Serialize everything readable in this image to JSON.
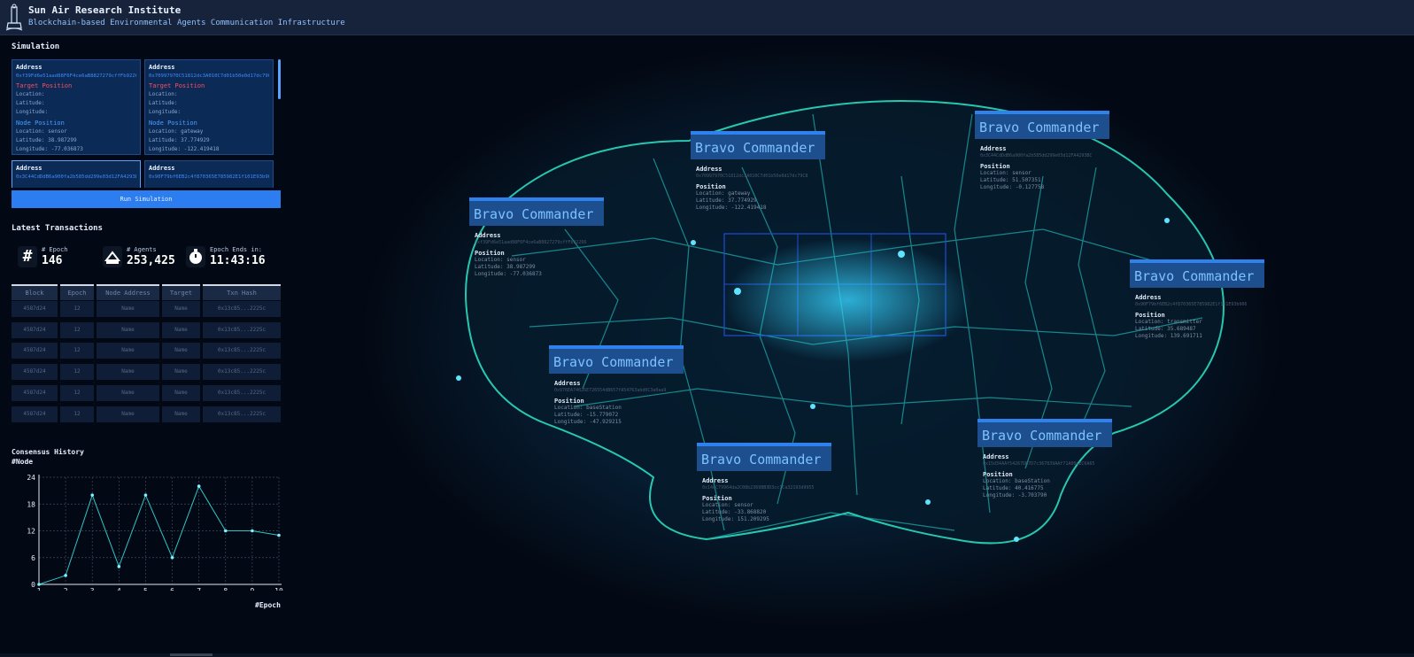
{
  "header": {
    "title": "Sun Air Research Institute",
    "subtitle": "Blockchain-based Environmental Agents Communication Infrastructure"
  },
  "simulation": {
    "title": "Simulation",
    "cards": [
      {
        "address_label": "Address",
        "address": "0xf39Fd6e51aad88F6F4ce6aB8827279cffFb92266",
        "target_label": "Target Position",
        "location": "Location:",
        "latitude": "Latitude:",
        "longitude": "Longitude:",
        "node_label": "Node Position",
        "node_location": "Location: sensor",
        "node_latitude": "Latitude: 38.987299",
        "node_longitude": "Longitude: -77.036873"
      },
      {
        "address_label": "Address",
        "address": "0x70997970C51812dc3A010C7d01b50e0d17dc79C8",
        "target_label": "Target Position",
        "location": "Location:",
        "latitude": "Latitude:",
        "longitude": "Longitude:",
        "node_label": "Node Position",
        "node_location": "Location: gateway",
        "node_latitude": "Latitude: 37.774929",
        "node_longitude": "Longitude: -122.419418"
      },
      {
        "address_label": "Address",
        "address": "0x3C44CdDdB6a900fa2b585dd299e03d12FA4293BC"
      },
      {
        "address_label": "Address",
        "address": "0x90F79bf6EB2c4f870365E785982E1f101E93b906"
      }
    ],
    "run_button": "Run Simulation"
  },
  "transactions": {
    "title": "Latest Transactions",
    "stats": [
      {
        "icon": "hash-icon",
        "label": "# Epoch",
        "value": "146"
      },
      {
        "icon": "agents-icon",
        "label": "# Agents",
        "value": "253,425"
      },
      {
        "icon": "stopwatch-icon",
        "label": "Epoch Ends in:",
        "value": "11:43:16"
      }
    ],
    "columns": [
      "Block",
      "Epoch",
      "Node Address",
      "Target",
      "Txn Hash"
    ],
    "rows": [
      [
        "4587d24",
        "12",
        "Name",
        "Name",
        "0x13c85...2225c"
      ],
      [
        "4587d24",
        "12",
        "Name",
        "Name",
        "0x13c85...2225c"
      ],
      [
        "4587d24",
        "12",
        "Name",
        "Name",
        "0x13c85...2225c"
      ],
      [
        "4587d24",
        "12",
        "Name",
        "Name",
        "0x13c85...2225c"
      ],
      [
        "4587d24",
        "12",
        "Name",
        "Name",
        "0x13c85...2225c"
      ],
      [
        "4587d24",
        "12",
        "Name",
        "Name",
        "0x13c85...2225c"
      ]
    ]
  },
  "consensus": {
    "title": "Consensus History",
    "y_label": "#Node",
    "x_label": "#Epoch"
  },
  "chart_data": {
    "type": "line",
    "x": [
      1,
      2,
      3,
      4,
      5,
      6,
      7,
      8,
      9,
      10
    ],
    "values": [
      0,
      2,
      20,
      4,
      20,
      6,
      22,
      12,
      12,
      11
    ],
    "yticks": [
      0,
      6,
      12,
      18,
      24
    ],
    "xticks": [
      1,
      2,
      3,
      4,
      5,
      6,
      7,
      8,
      9,
      10
    ],
    "ylim": [
      0,
      24
    ],
    "xlim": [
      1,
      10
    ],
    "grid": true,
    "color": "#2ec4c4"
  },
  "map_popups": [
    {
      "title": "Bravo Commander",
      "address_label": "Address",
      "address": "0xf39Fd6e51aad88F6F4ce6aB8827279cffFb92266",
      "position_label": "Position",
      "location": "Location: sensor",
      "latitude": "Latitude: 38.987299",
      "longitude": "Longitude: -77.036873"
    },
    {
      "title": "Bravo Commander",
      "address_label": "Address",
      "address": "0x70997970C51812dc3A010C7d01b50e0d17dc79C8",
      "position_label": "Position",
      "location": "Location: gateway",
      "latitude": "Latitude: 37.774929",
      "longitude": "Longitude: -122.419418"
    },
    {
      "title": "Bravo Commander",
      "address_label": "Address",
      "address": "0x3C44CdDdB6a900fa2b585dd299e03d12FA4293BC",
      "position_label": "Position",
      "location": "Location: sensor",
      "latitude": "Latitude: 51.507351",
      "longitude": "Longitude: -0.127758"
    },
    {
      "title": "Bravo Commander",
      "address_label": "Address",
      "address": "0x90F79bf6EB2c4f870365E785982E1f101E93b906",
      "position_label": "Position",
      "location": "Location: transmitter",
      "latitude": "Latitude: 35.689487",
      "longitude": "Longitude: 139.691711"
    },
    {
      "title": "Bravo Commander",
      "address_label": "Address",
      "address": "0x15d34AAf54267DB7D7c367839AAf71A00a2C6A65",
      "position_label": "Position",
      "location": "Location: baseStation",
      "latitude": "Latitude: 40.416775",
      "longitude": "Longitude: -3.703790"
    },
    {
      "title": "Bravo Commander",
      "address_label": "Address",
      "address": "0x976EA74026E726554dB657fA54763abd0C3a0aa9",
      "position_label": "Position",
      "location": "Location: baseStation",
      "latitude": "Latitude: -15.779072",
      "longitude": "Longitude: -47.929215"
    },
    {
      "title": "Bravo Commander",
      "address_label": "Address",
      "address": "0x14dC79964da2C08b23698B3D3cc7Ca32193d9955",
      "position_label": "Position",
      "location": "Location: sensor",
      "latitude": "Latitude: -33.868820",
      "longitude": "Longitude: 151.209295"
    }
  ]
}
